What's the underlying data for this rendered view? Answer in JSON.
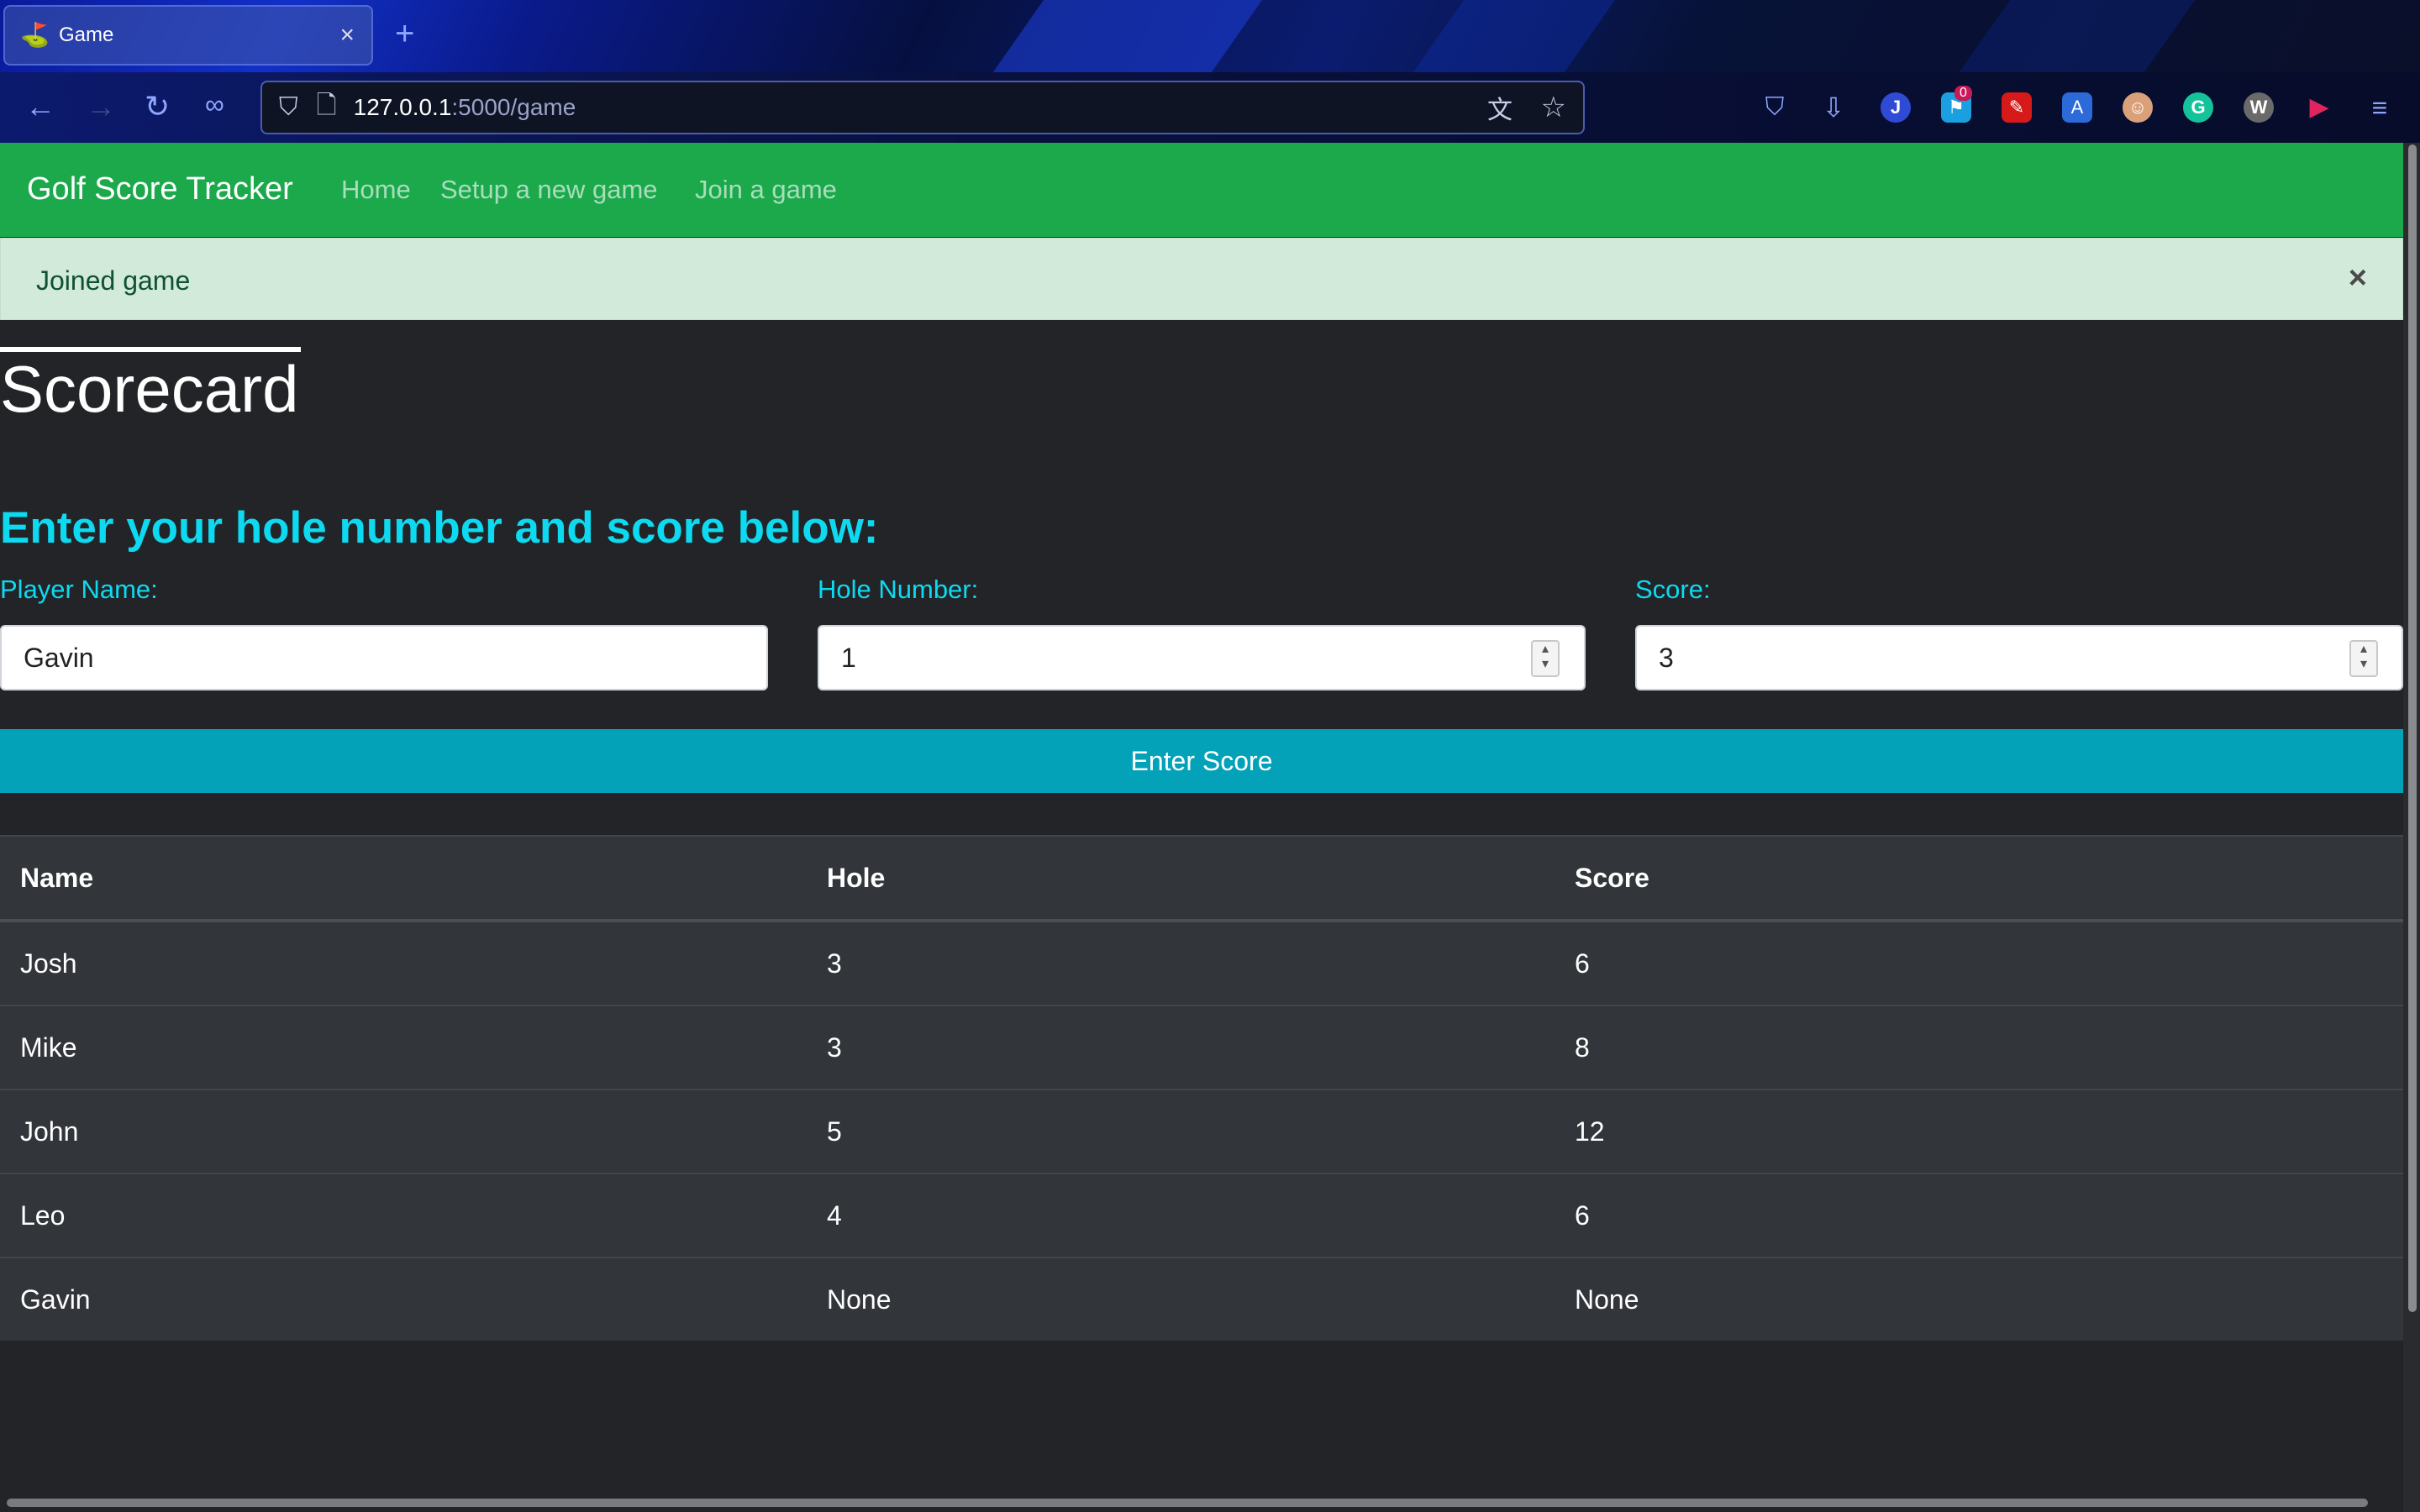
{
  "browser": {
    "tab_title": "Game",
    "url_host": "127.0.0.1",
    "url_path": ":5000/game",
    "extension_badge": "0",
    "extension_letter_j": "J"
  },
  "site": {
    "brand": "Golf Score Tracker",
    "nav": [
      "Home",
      "Setup a new game",
      "Join a game"
    ],
    "accent_color": "#1ba94c"
  },
  "alert": {
    "message": "Joined game",
    "close_symbol": "×"
  },
  "main": {
    "title": "Scorecard",
    "subtitle": "Enter your hole number and score below:",
    "form": {
      "player_label": "Player Name:",
      "player_value": "Gavin",
      "hole_label": "Hole Number:",
      "hole_value": "1",
      "score_label": "Score:",
      "score_value": "3",
      "submit_label": "Enter Score"
    },
    "table": {
      "headers": [
        "Name",
        "Hole",
        "Score"
      ],
      "rows": [
        [
          "Josh",
          "3",
          "6"
        ],
        [
          "Mike",
          "3",
          "8"
        ],
        [
          "John",
          "5",
          "12"
        ],
        [
          "Leo",
          "4",
          "6"
        ],
        [
          "Gavin",
          "None",
          "None"
        ]
      ]
    }
  }
}
